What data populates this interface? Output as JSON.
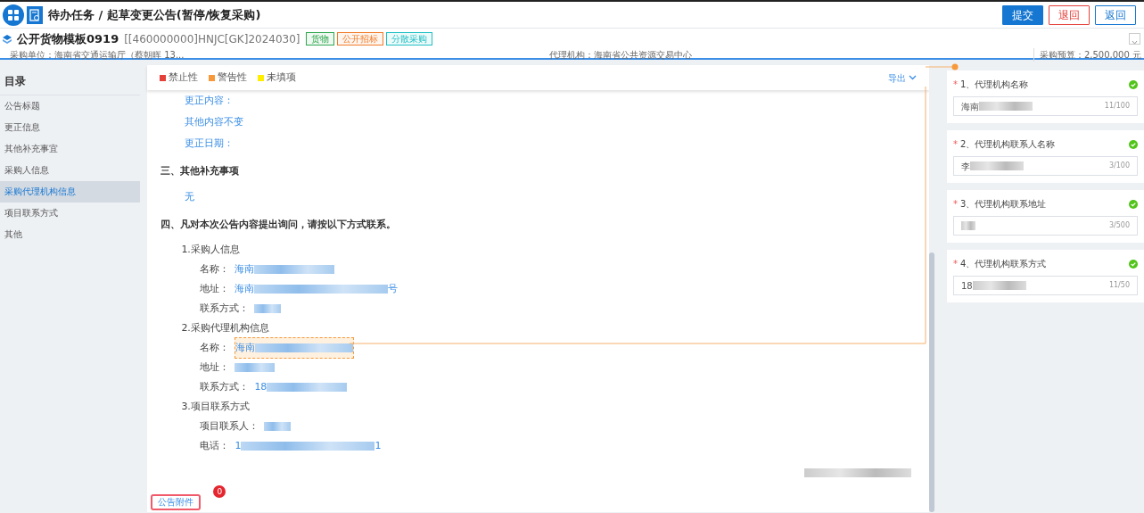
{
  "topbar": {
    "title": "待办任务 / 起草变更公告(暂停/恢复采购)",
    "buttons": [
      {
        "label": "提交",
        "kind": "primary"
      },
      {
        "label": "退回",
        "kind": "danger"
      },
      {
        "label": "返回",
        "kind": "outline"
      }
    ]
  },
  "project": {
    "name": "公开货物模板0919",
    "code": "[[460000000]HNJC[GK]2024030]",
    "tags": [
      {
        "label": "货物",
        "color": "#2fa84f"
      },
      {
        "label": "公开招标",
        "color": "#f07c2b"
      },
      {
        "label": "分散采购",
        "color": "#1fbfc4"
      }
    ],
    "meta": [
      "采购单位：海南省交通运输厅（蔡朝晖 13...",
      "代理机构：海南省公共资源交易中心",
      "采购预算：2,500,000 元"
    ]
  },
  "sidebar": {
    "title": "目录",
    "items": [
      {
        "label": "公告标题",
        "selected": false
      },
      {
        "label": "更正信息",
        "selected": false
      },
      {
        "label": "其他补充事宜",
        "selected": false
      },
      {
        "label": "采购人信息",
        "selected": false
      },
      {
        "label": "采购代理机构信息",
        "selected": true
      },
      {
        "label": "项目联系方式",
        "selected": false
      },
      {
        "label": "其他",
        "selected": false
      }
    ]
  },
  "legend": [
    {
      "label": "禁止性",
      "color": "#e5413b"
    },
    {
      "label": "警告性",
      "color": "#f7993a"
    },
    {
      "label": "未填项",
      "color": "#ffee00"
    }
  ],
  "export": "导出",
  "document": [
    {
      "kind": "line",
      "text": "更正内容："
    },
    {
      "kind": "line",
      "text": "其他内容不变"
    },
    {
      "kind": "line",
      "text": "更正日期："
    },
    {
      "kind": "heading",
      "text": "三、其他补充事项"
    },
    {
      "kind": "line",
      "text": "无"
    },
    {
      "kind": "heading",
      "text": "四、凡对本次公告内容提出询问，请按以下方式联系。"
    },
    {
      "kind": "subheading",
      "text": "1.采购人信息"
    },
    {
      "kind": "field",
      "label": "名称：",
      "value": "海南",
      "redacted": true,
      "highlighted": false
    },
    {
      "kind": "field",
      "label": "地址：",
      "value": "海南",
      "redacted": true,
      "suffix": "号",
      "highlighted": false
    },
    {
      "kind": "field",
      "label": "联系方式：",
      "redacted": true,
      "highlighted": false
    },
    {
      "kind": "subheading",
      "text": "2.采购代理机构信息"
    },
    {
      "kind": "field",
      "label": "名称：",
      "value": "海南",
      "redacted": true,
      "highlighted": true
    },
    {
      "kind": "field",
      "label": "地址：",
      "redacted": true,
      "highlighted": false
    },
    {
      "kind": "field",
      "label": "联系方式：",
      "value": "18",
      "redacted": true,
      "highlighted": false
    },
    {
      "kind": "subheading",
      "text": "3.项目联系方式"
    },
    {
      "kind": "field",
      "label": "项目联系人：",
      "redacted": true,
      "highlighted": false
    },
    {
      "kind": "field",
      "label": "电话：",
      "value": "1",
      "redacted": true,
      "suffix": "1",
      "highlighted": false
    },
    {
      "kind": "signature",
      "redacted": true
    }
  ],
  "attachment": {
    "label": "公告附件",
    "count": "0"
  },
  "form": [
    {
      "label": "1、代理机构名称",
      "required_mark": "*",
      "valid": true,
      "value": "海南",
      "redacted": true,
      "counter": "11/100"
    },
    {
      "label": "2、代理机构联系人名称",
      "required_mark": "*",
      "valid": true,
      "value": "李",
      "redacted": true,
      "counter": "3/100"
    },
    {
      "label": "3、代理机构联系地址",
      "required_mark": "*",
      "valid": true,
      "redacted": true,
      "counter": "3/500"
    },
    {
      "label": "4、代理机构联系方式",
      "required_mark": "*",
      "valid": true,
      "value": "18",
      "redacted": true,
      "counter": "11/50"
    }
  ]
}
